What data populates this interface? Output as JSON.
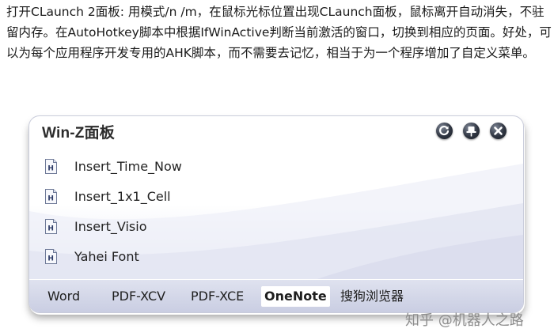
{
  "article": {
    "text": "打开CLaunch 2面板: 用模式/n /m，在鼠标光标位置出现CLaunch面板，鼠标离开自动消失，不驻留内存。在AutoHotkey脚本中根据IfWinActive判断当前激活的窗口，切换到相应的页面。好处，可以为每个应用程序开发专用的AHK脚本，而不需要去记忆，相当于为一个程序增加了自定义菜单。"
  },
  "panel": {
    "title": "Win-Z面板",
    "controls": [
      {
        "icon": "refresh-icon"
      },
      {
        "icon": "pin-icon"
      },
      {
        "icon": "close-icon"
      }
    ],
    "items": [
      {
        "label": "Insert_Time_Now",
        "icon": "file-h-icon"
      },
      {
        "label": "Insert_1x1_Cell",
        "icon": "file-h-icon"
      },
      {
        "label": "Insert_Visio",
        "icon": "file-h-icon"
      },
      {
        "label": "Yahei Font",
        "icon": "file-h-icon"
      }
    ],
    "tabs": [
      {
        "label": "Word",
        "active": false
      },
      {
        "label": "PDF-XCV",
        "active": false
      },
      {
        "label": "PDF-XCE",
        "active": false
      },
      {
        "label": "OneNote",
        "active": true
      },
      {
        "label": "搜狗浏览器",
        "active": false
      }
    ]
  },
  "watermark": "知乎 @机器人之路",
  "colors": {
    "panel_bg_bottom": "#dde0ef",
    "tab_active_bg": "#ffffff",
    "control_dark": "#2f3541"
  }
}
